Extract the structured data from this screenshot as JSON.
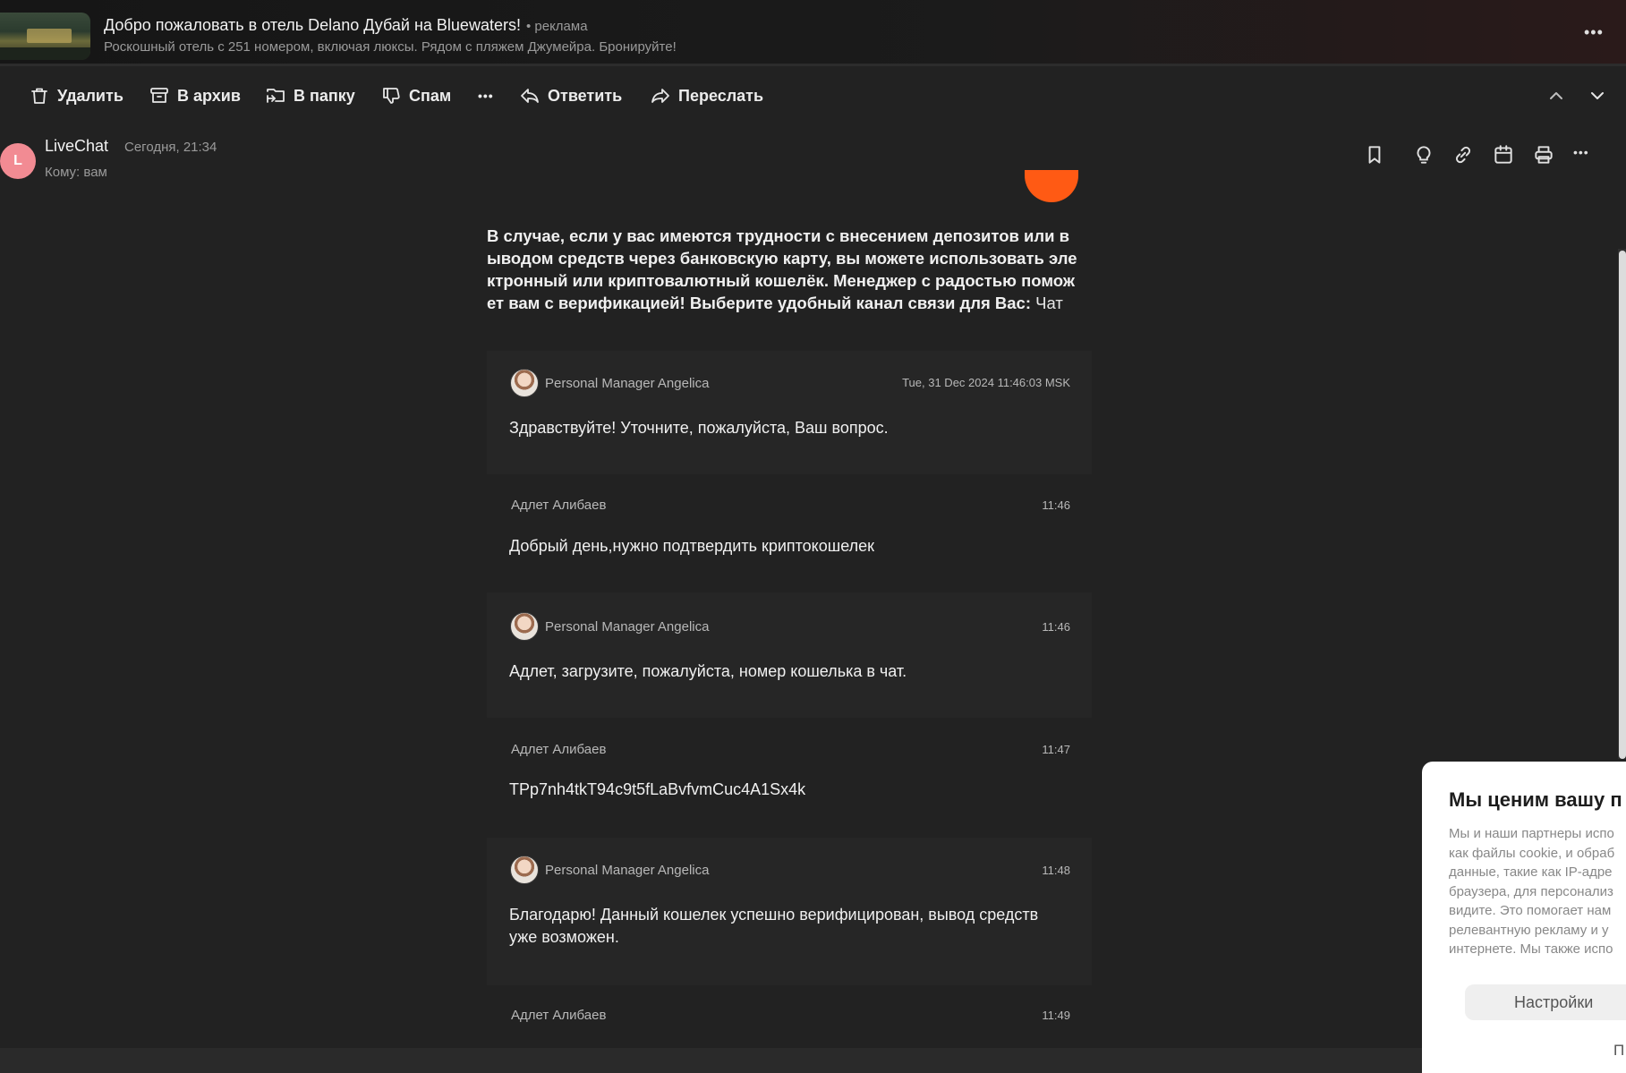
{
  "ad": {
    "title": "Добро пожаловать в отель Delano Дубай на Bluewaters!",
    "tag": "• реклама",
    "subtitle": "Роскошный отель с 251 номером, включая люксы. Рядом с пляжем Джумейра. Бронируйте!",
    "more": "•••"
  },
  "toolbar": {
    "delete": "Удалить",
    "archive": "В архив",
    "folder": "В папку",
    "spam": "Спам",
    "more": "•••",
    "reply": "Ответить",
    "forward": "Переслать"
  },
  "message": {
    "avatar_letter": "L",
    "sender": "LiveChat",
    "date": "Сегодня, 21:34",
    "recipient": "Кому: вам",
    "header_more": "•••",
    "intro_lines": [
      "В случае, если у вас имеются трудности с внесением депозитов или в",
      "ыводом средств через банковскую карту, вы можете использовать эле",
      "ктронный или криптовалютный кошелёк. Менеджер с радостью помож",
      "ет вам с верификацией! Выберите удобный канал связи для Вас:"
    ],
    "intro_link": "Чат"
  },
  "chat": [
    {
      "role": "manager",
      "author": "Personal Manager Angelica",
      "time": "Tue, 31 Dec 2024 11:46:03 MSK",
      "lines": [
        "Здравствуйте! Уточните, пожалуйста, Ваш вопрос."
      ]
    },
    {
      "role": "user",
      "author": "Адлет Алибаев",
      "time": "11:46",
      "lines": [
        "Добрый день,нужно подтвердить криптокошелек"
      ]
    },
    {
      "role": "manager",
      "author": "Personal Manager Angelica",
      "time": "11:46",
      "lines": [
        "Адлет, загрузите, пожалуйста, номер кошелька в чат."
      ]
    },
    {
      "role": "user",
      "author": "Адлет Алибаев",
      "time": "11:47",
      "lines": [
        "TPp7nh4tkT94c9t5fLaBvfvmCuc4A1Sx4k"
      ]
    },
    {
      "role": "manager",
      "author": "Personal Manager Angelica",
      "time": "11:48",
      "lines": [
        "Благодарю! Данный кошелек успешно верифицирован, вывод средств",
        "уже возможен."
      ]
    },
    {
      "role": "user",
      "author": "Адлет Алибаев",
      "time": "11:49",
      "lines": []
    }
  ],
  "cookie": {
    "title": "Мы ценим вашу п",
    "lines": [
      "Мы и наши партнеры испо",
      "как файлы cookie, и обраб",
      "данные, такие как IP-адре",
      "браузера, для персонализ",
      "видите. Это помогает нам",
      "релевантную рекламу и у",
      "интернете. Мы также испо"
    ],
    "settings_button": "Настройки",
    "more_label": "П"
  },
  "colors": {
    "background": "#222222",
    "accent_orange": "#ff5a14",
    "avatar_pink": "#f28b93"
  }
}
